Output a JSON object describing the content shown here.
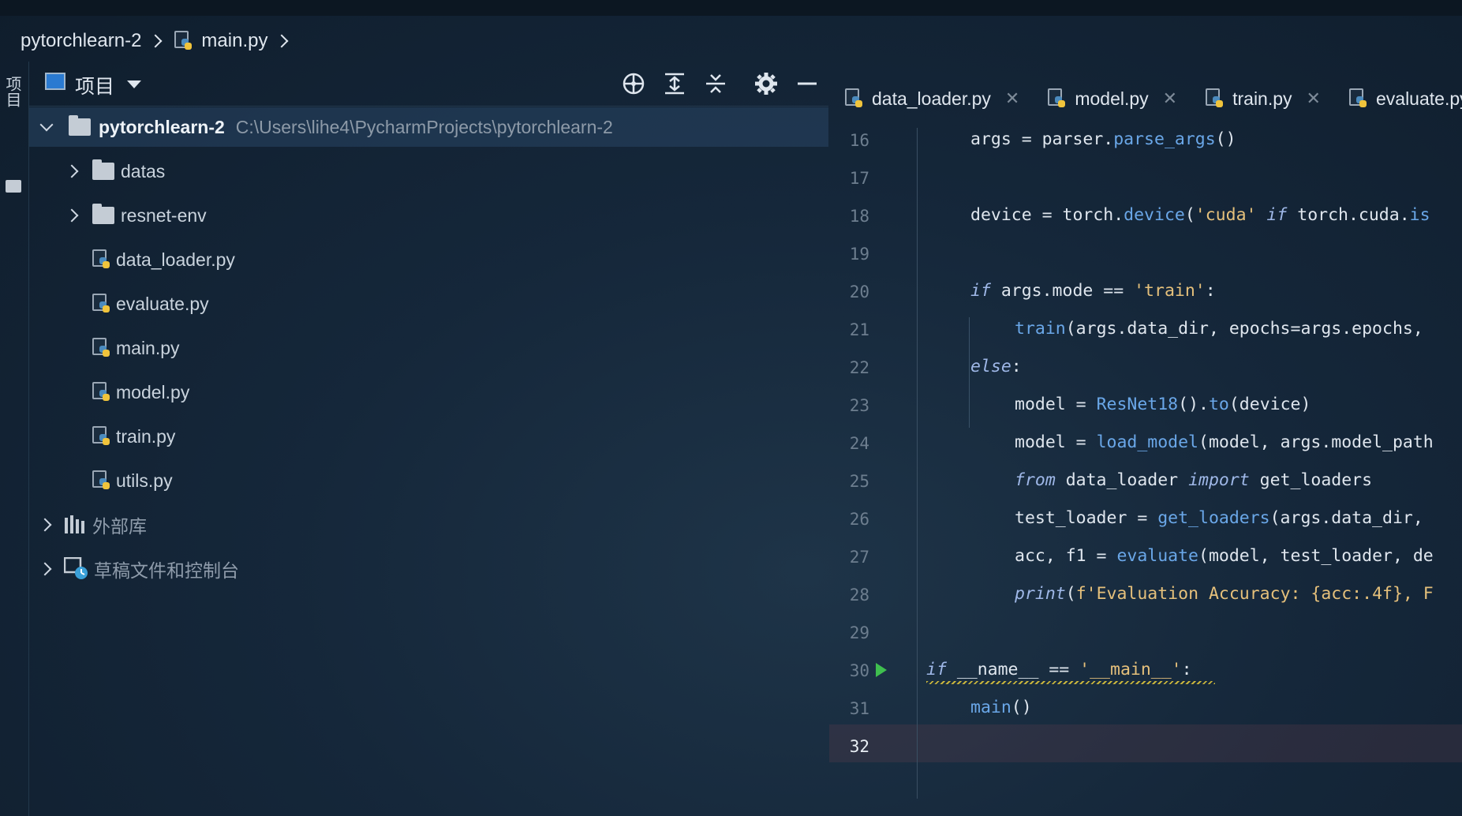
{
  "breadcrumb": {
    "project": "pytorchlearn-2",
    "file": "main.py"
  },
  "side_strip": {
    "label": "项目"
  },
  "project_panel": {
    "title": "项目",
    "root": {
      "name": "pytorchlearn-2",
      "path": "C:\\Users\\lihe4\\PycharmProjects\\pytorchlearn-2"
    },
    "items": [
      {
        "name": "datas",
        "kind": "folder"
      },
      {
        "name": "resnet-env",
        "kind": "folder"
      },
      {
        "name": "data_loader.py",
        "kind": "py"
      },
      {
        "name": "evaluate.py",
        "kind": "py"
      },
      {
        "name": "main.py",
        "kind": "py"
      },
      {
        "name": "model.py",
        "kind": "py"
      },
      {
        "name": "train.py",
        "kind": "py"
      },
      {
        "name": "utils.py",
        "kind": "py"
      }
    ],
    "external": "外部库",
    "scratches": "草稿文件和控制台"
  },
  "editor_tabs": [
    "data_loader.py",
    "model.py",
    "train.py",
    "evaluate.py"
  ],
  "line_numbers": [
    "16",
    "17",
    "18",
    "19",
    "20",
    "21",
    "22",
    "23",
    "24",
    "25",
    "26",
    "27",
    "28",
    "29",
    "30",
    "31",
    "32"
  ],
  "current_line": "32"
}
